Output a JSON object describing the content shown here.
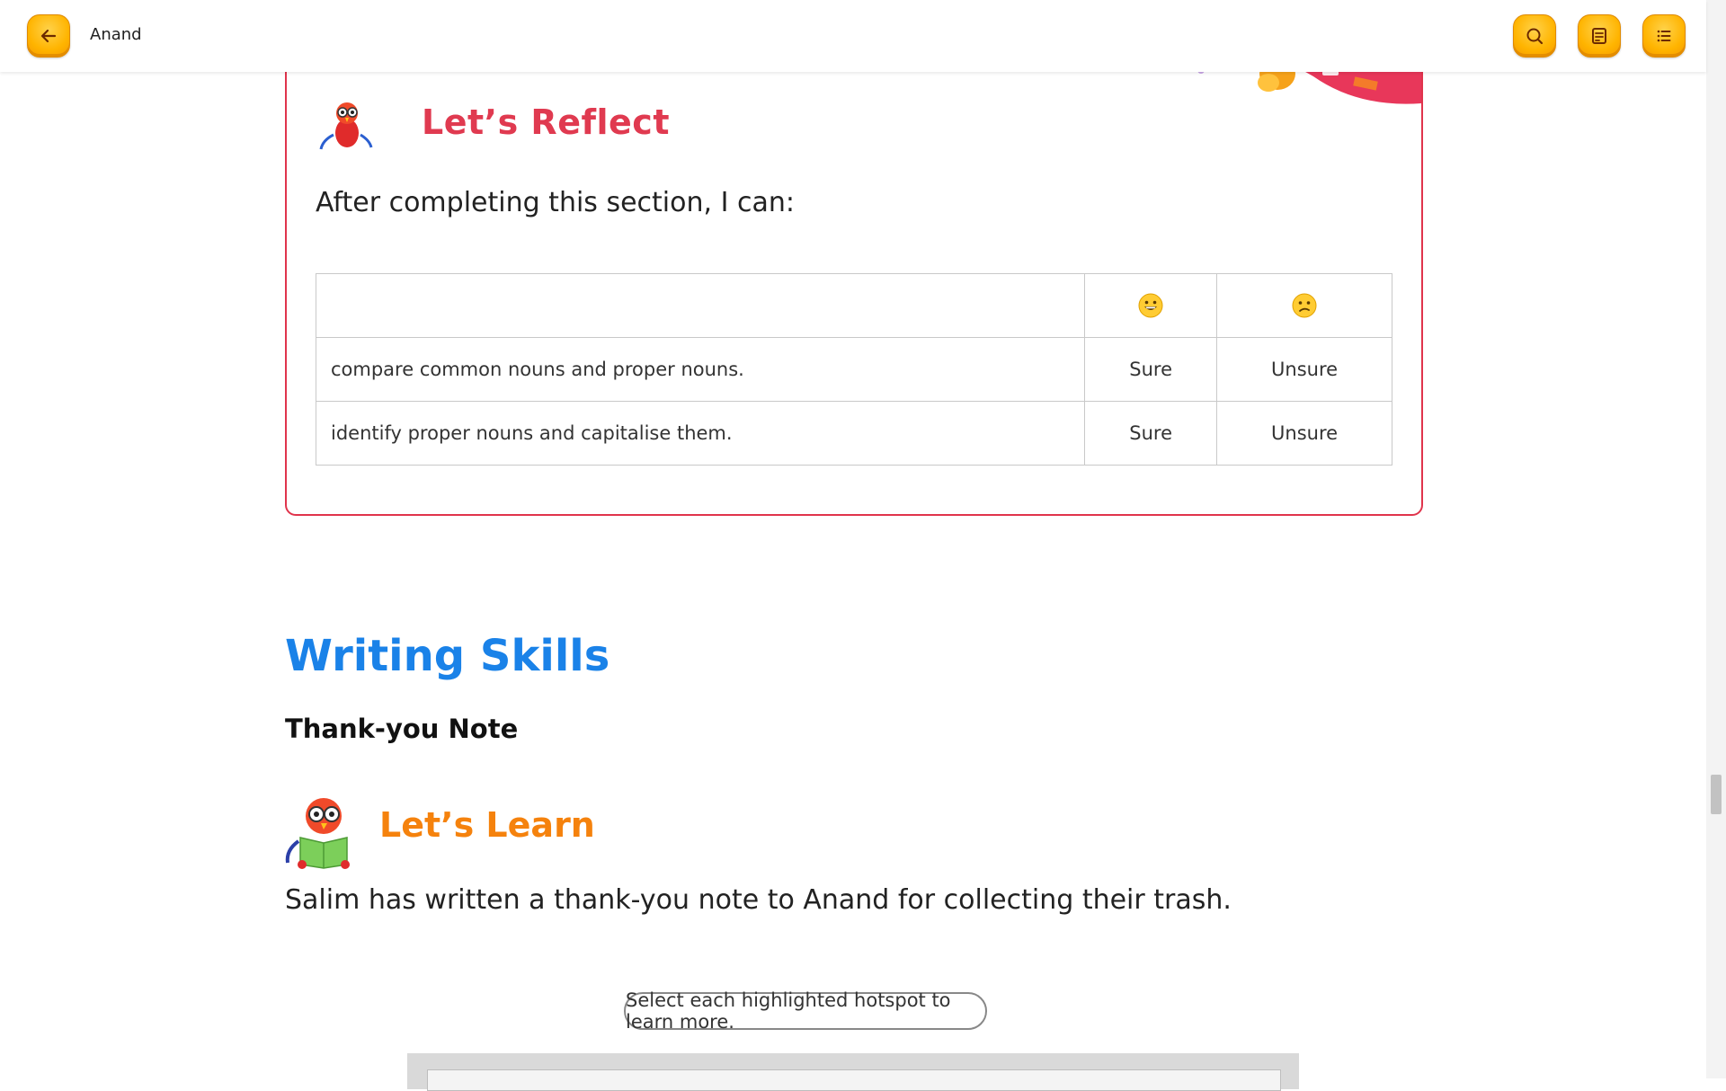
{
  "topbar": {
    "title": "Anand",
    "back_icon": "arrow-left-icon",
    "search_icon": "search-icon",
    "notes_icon": "notes-icon",
    "menu_icon": "list-icon"
  },
  "reflect": {
    "title": "Let’s Reflect",
    "intro": "After completing this section, I can:",
    "table": {
      "header_icons": [
        "grinning-face-icon",
        "confused-face-icon"
      ],
      "rows": [
        {
          "statement": "compare common nouns and proper nouns.",
          "sure": "Sure",
          "unsure": "Unsure"
        },
        {
          "statement": "identify proper nouns and capitalise them.",
          "sure": "Sure",
          "unsure": "Unsure"
        }
      ]
    }
  },
  "writing": {
    "section_title": "Writing Skills",
    "sub_title": "Thank-you Note",
    "learn_title": "Let’s Learn",
    "learn_text": "Salim has written a thank-you note to Anand for collecting their trash.",
    "hotspot_prompt": "Select each highlighted hotspot to learn more."
  },
  "colors": {
    "accent_red": "#e03a50",
    "accent_blue": "#1a82e8",
    "accent_orange": "#f5820d",
    "button_yellow": "#ffb400"
  }
}
